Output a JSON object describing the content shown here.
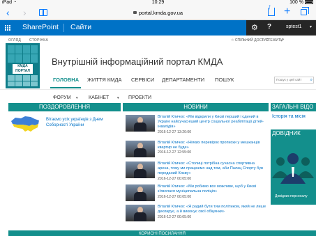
{
  "status": {
    "device": "iPad",
    "wifi": "◔",
    "time": "10:29",
    "battery": "100 %"
  },
  "browser": {
    "url": "portal.kmda.gov.ua"
  },
  "suitebar": {
    "brand": "SharePoint",
    "sites": "Сайти",
    "user": "sptest1",
    "user_caret": "▾"
  },
  "ribbon": {
    "browse": "ОГЛЯД",
    "page": "СТОРІНКА",
    "share": "☆ СПІЛЬНИЙ ДОСТУП",
    "follow": "☆ СТЕЖИТИ",
    "fullscreen": "⤢"
  },
  "logo": {
    "line1": "КМДА",
    "line2": "ПОРТАЛ"
  },
  "portal_title": "Внутрішній інформаційний портал КМДА",
  "search": {
    "placeholder": "Пошук у цей сайт"
  },
  "nav": [
    "ГОЛОВНА",
    "ЖИТТЯ КМДА",
    "СЕРВІСИ",
    "ДЕПАРТАМЕНТИ",
    "ПОШУК"
  ],
  "subnav": {
    "forum": "ФОРУМ",
    "cabinet": "КАБІНЕТ",
    "projects": "ПРОЕКТИ",
    "caret": "▾"
  },
  "congrats": {
    "header": "ПОЗДОРОВЛЕННЯ",
    "text": "Вітаємо усіх українців з Днем Соборності України"
  },
  "news": {
    "header": "НОВИНИ",
    "items": [
      {
        "text": "Віталій Кличко: «Ми відкрили у Києві перший і єдиний в Україні найсучасніший центр соціальної реабілітації дітей-інвалідів»",
        "date": "2016-12-27 13:20:00"
      },
      {
        "text": "Віталій Кличко: «Ніяких перевірок прописки у мешканців квартир не буде»",
        "date": "2016-12-27 12:55:00"
      },
      {
        "text": "Віталій Кличко: «Столиці потрібна сучасна спортивна арена, тому ми працюємо над тим, аби Палац Спорту був переданий Києву»",
        "date": "2016-12-27 00:05:00"
      },
      {
        "text": "Віталій Кличко: «Ми робимо все можливе, щоб у Києві з'явилася муніципальна поліція»",
        "date": "2016-12-27 00:05:00"
      },
      {
        "text": "Віталій Кличко: «Я радий бути тим політиком, який не лише декларує, а й виконує свої обіцянки»",
        "date": "2016-12-27 00:05:00"
      }
    ]
  },
  "general": {
    "header": "ЗАГАЛЬНІ ВІДО",
    "link": "Історія та місія"
  },
  "directory": {
    "header": "ДОВІДНИК",
    "caption": "Довідник персоналу"
  },
  "bottom": {
    "header": "КОРИСНІ ПОСИЛАННЯ"
  },
  "colors": {
    "suitebar": "#0072c6",
    "accent": "#138f8c",
    "link": "#0072c6"
  }
}
